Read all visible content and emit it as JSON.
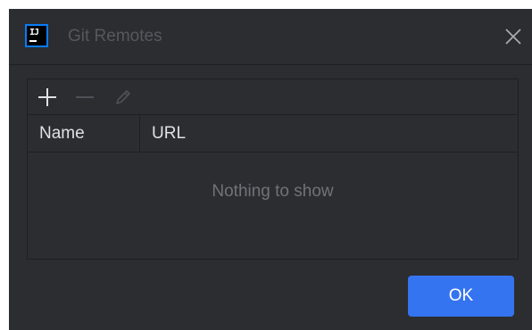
{
  "dialog": {
    "title": "Git Remotes",
    "app_icon_text": "IJ",
    "icons": {
      "app": "intellij-idea-icon",
      "close": "close-icon",
      "add": "plus-icon",
      "remove": "minus-icon",
      "edit": "pencil-icon"
    }
  },
  "table": {
    "columns": [
      "Name",
      "URL"
    ],
    "rows": [],
    "empty_text": "Nothing to show"
  },
  "buttons": {
    "ok_label": "OK"
  },
  "colors": {
    "background": "#2b2d30",
    "accent": "#3574f0",
    "app_icon_border": "#087cfa"
  }
}
